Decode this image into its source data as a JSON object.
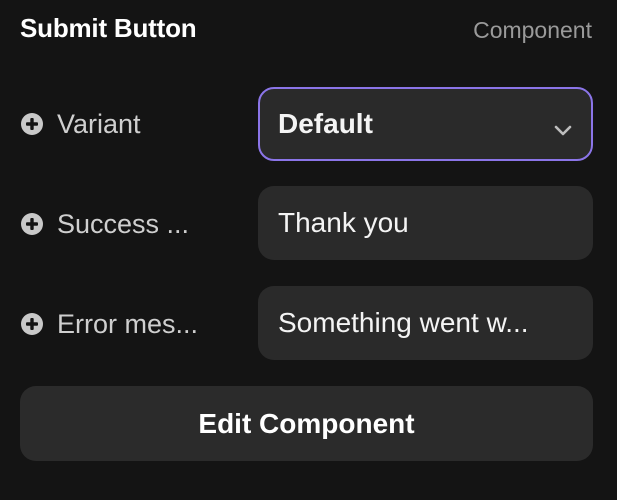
{
  "header": {
    "title": "Submit Button",
    "kind": "Component"
  },
  "properties": [
    {
      "label": "Variant",
      "value": "Default",
      "type": "select",
      "icon": "plus-circle-icon"
    },
    {
      "label": "Success ...",
      "value": "Thank you",
      "type": "text",
      "icon": "plus-circle-icon"
    },
    {
      "label": "Error mes...",
      "value": "Something went w...",
      "type": "text",
      "icon": "plus-circle-icon"
    }
  ],
  "actions": {
    "edit_label": "Edit Component"
  },
  "colors": {
    "background": "#141414",
    "field": "#2a2a2a",
    "accent_border": "#8b75e8",
    "muted_text": "#9a9a9a"
  }
}
